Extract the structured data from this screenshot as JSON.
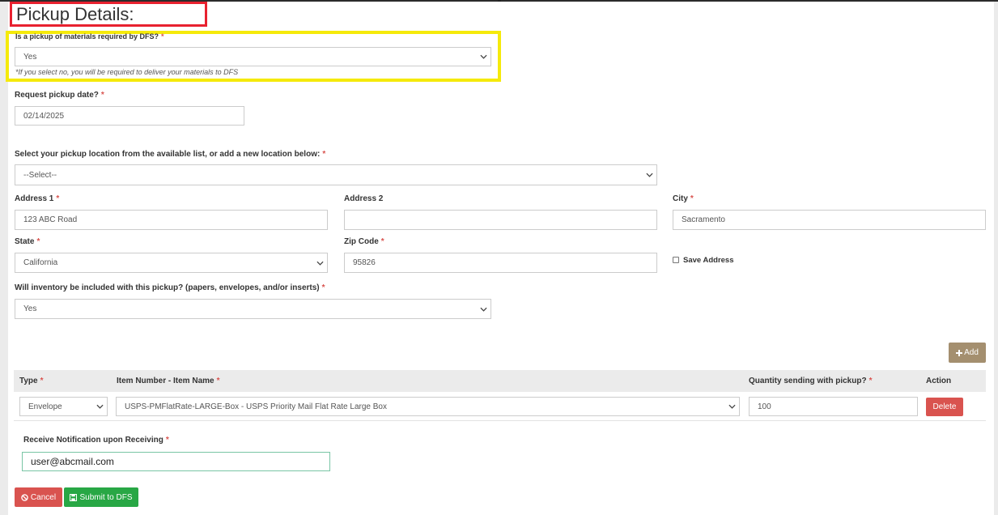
{
  "page": {
    "title": "Pickup Details:"
  },
  "pickup_required": {
    "label": "Is a pickup of materials required by DFS?",
    "required_mark": "*",
    "value": "Yes",
    "help": "*If you select no, you will be required to deliver your materials to DFS"
  },
  "pickup_date": {
    "label": "Request pickup date?",
    "required_mark": "*",
    "value": "02/14/2025"
  },
  "location": {
    "label": "Select your pickup location from the available list, or add a new location below:",
    "required_mark": "*",
    "value": "--Select--"
  },
  "address": {
    "address1_label": "Address 1",
    "address1_value": "123 ABC Road",
    "address2_label": "Address 2",
    "address2_value": "",
    "city_label": "City",
    "city_value": "Sacramento",
    "state_label": "State",
    "state_value": "California",
    "zip_label": "Zip Code",
    "zip_value": "95826",
    "save_label": "Save Address",
    "required_mark": "*"
  },
  "inventory": {
    "label": "Will inventory be included with this pickup? (papers, envelopes, and/or inserts)",
    "required_mark": "*",
    "value": "Yes"
  },
  "items_table": {
    "add_label": "Add",
    "headers": {
      "type": "Type",
      "item": "Item Number - Item Name",
      "quantity": "Quantity sending with pickup?",
      "action": "Action"
    },
    "required_mark": "*",
    "rows": [
      {
        "type": "Envelope",
        "item": "USPS-PMFlatRate-LARGE-Box - USPS Priority Mail Flat Rate Large Box",
        "quantity": "100",
        "delete_label": "Delete"
      }
    ]
  },
  "notification": {
    "label": "Receive Notification upon Receiving",
    "required_mark": "*",
    "value": "user@abcmail.com"
  },
  "footer": {
    "cancel_label": "Cancel",
    "submit_label": "Submit to DFS"
  },
  "colors": {
    "required": "#d9534f",
    "add_button": "#a48f6f",
    "delete_button": "#d9534f",
    "cancel_button": "#d9534f",
    "submit_button": "#28a745",
    "highlight_red": "#e8212f",
    "highlight_yellow": "#f5ea0b"
  }
}
